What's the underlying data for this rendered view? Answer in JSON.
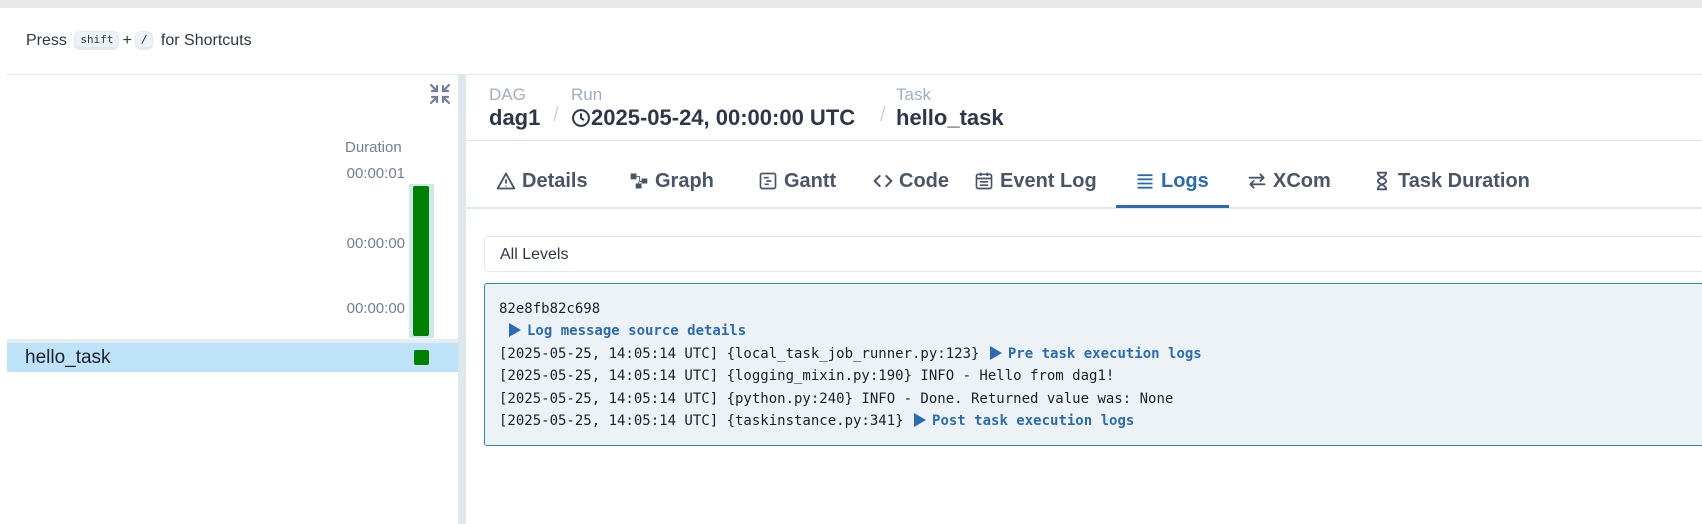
{
  "shortcuts": {
    "press": "Press",
    "key1": "shift",
    "plus": "+",
    "key2": "/",
    "suffix": "for Shortcuts"
  },
  "grid": {
    "duration_title": "Duration",
    "ticks": [
      "00:00:01",
      "00:00:00",
      "00:00:00"
    ],
    "task": {
      "name": "hello_task",
      "status_color": "#008000"
    }
  },
  "breadcrumb": {
    "dag_label": "DAG",
    "dag_value": "dag1",
    "run_label": "Run",
    "run_value": "2025-05-24, 00:00:00 UTC",
    "task_label": "Task",
    "task_value": "hello_task"
  },
  "tabs": [
    {
      "label": "Details",
      "icon": "warning-icon"
    },
    {
      "label": "Graph",
      "icon": "graph-icon"
    },
    {
      "label": "Gantt",
      "icon": "gantt-icon"
    },
    {
      "label": "Code",
      "icon": "code-icon"
    },
    {
      "label": "Event Log",
      "icon": "calendar-icon"
    },
    {
      "label": "Logs",
      "icon": "list-icon",
      "active": true
    },
    {
      "label": "XCom",
      "icon": "swap-icon"
    },
    {
      "label": "Task Duration",
      "icon": "hourglass-icon"
    }
  ],
  "logs": {
    "level_select": "All Levels",
    "host": "82e8fb82c698",
    "source_details": "Log message source details",
    "lines": [
      {
        "text": "[2025-05-25, 14:05:14 UTC] {local_task_job_runner.py:123}",
        "link": "Pre task execution logs"
      },
      {
        "text": "[2025-05-25, 14:05:14 UTC] {logging_mixin.py:190} INFO - Hello from dag1!"
      },
      {
        "text": "[2025-05-25, 14:05:14 UTC] {python.py:240} INFO - Done. Returned value was: None"
      },
      {
        "text": "[2025-05-25, 14:05:14 UTC] {taskinstance.py:341}",
        "link": "Post task execution logs"
      }
    ]
  },
  "colors": {
    "accent": "#2b6cb0",
    "success": "#008000",
    "selected_row": "#bee3f8"
  }
}
